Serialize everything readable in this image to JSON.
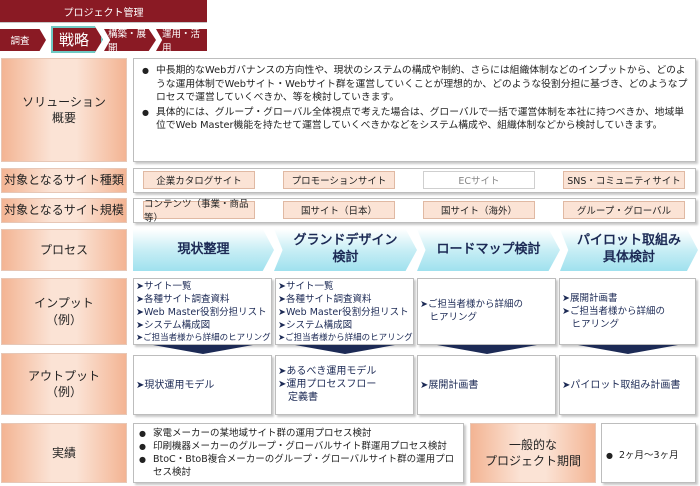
{
  "header": {
    "title": "プロジェクト管理",
    "steps": [
      "調査",
      "戦略",
      "構築・展開",
      "運用・活用"
    ]
  },
  "rows": {
    "solution": "ソリューション\n概要",
    "site_type": "対象となるサイト種類",
    "site_scale": "対象となるサイト規模",
    "process": "プロセス",
    "input": "インプット\n（例）",
    "output": "アウトプット\n（例）",
    "results": "実績"
  },
  "solution": [
    "中長期的なWebガバナンスの方向性や、現状のシステムの構成や制約、さらには組織体制などのインプットから、どのような運用体制でWebサイト・Webサイト群を運営していくことが理想的か、どのような役割分担に基づき、どのようなプロセスで運営していくべきか、等を検討していきます。",
    "具体的には、グループ・グローバル全体視点で考えた場合は、グローバルで一括で運営体制を本社に持つべきか、地域単位でWeb Master機能を持たせて運営していくべきかなどをシステム構成や、組織体制などから検討していきます。"
  ],
  "site_types": [
    {
      "label": "企業カタログサイト",
      "active": true
    },
    {
      "label": "プロモーションサイト",
      "active": true
    },
    {
      "label": "ECサイト",
      "active": false
    },
    {
      "label": "SNS・コミュニティサイト",
      "active": true
    }
  ],
  "site_scales": [
    {
      "label": "コンテンツ（事業・商品等）",
      "active": true
    },
    {
      "label": "国サイト（日本）",
      "active": true
    },
    {
      "label": "国サイト（海外）",
      "active": true
    },
    {
      "label": "グループ・グローバル",
      "active": true
    }
  ],
  "process": [
    "現状整理",
    "グランドデザイン\n検討",
    "ロードマップ検討",
    "パイロット取組み\n具体検討"
  ],
  "inputs": [
    [
      "➤サイト一覧",
      "➤各種サイト調査資料",
      "➤Web Master役割分担リスト",
      "➤システム構成図",
      "➤ご担当者様から詳細のヒアリング"
    ],
    [
      "➤サイト一覧",
      "➤各種サイト調査資料",
      "➤Web Master役割分担リスト",
      "➤システム構成図",
      "➤ご担当者様から詳細のヒアリング"
    ],
    [
      "➤ご担当者様から詳細の",
      "　ヒアリング"
    ],
    [
      "➤展開計画書",
      "➤ご担当者様から詳細の",
      "　ヒアリング"
    ]
  ],
  "outputs": [
    [
      "➤現状運用モデル"
    ],
    [
      "➤あるべき運用モデル",
      "➤運用プロセスフロー",
      "　定義書"
    ],
    [
      "➤展開計画書"
    ],
    [
      "➤パイロット取組み計画書"
    ]
  ],
  "results": [
    "家電メーカーの某地域サイト群の運用プロセス検討",
    "印刷機器メーカーのグループ・グローバルサイト群運用プロセス検討",
    "BtoC・BtoB複合メーカーのグループ・グローバルサイト群の運用プロセス検討"
  ],
  "period_label": "一般的な\nプロジェクト期間",
  "period_value": "2ヶ月〜3ヶ月"
}
